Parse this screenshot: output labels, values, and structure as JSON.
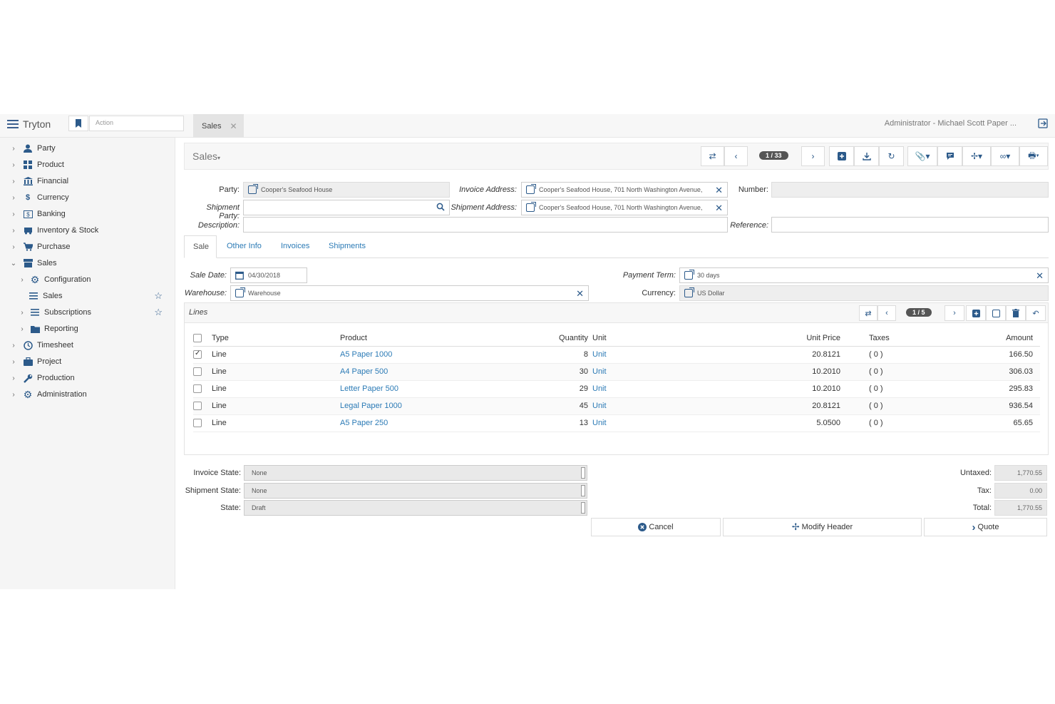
{
  "topbar": {
    "brand": "Tryton",
    "action_placeholder": "Action",
    "tab_label": "Sales",
    "user_info": "Administrator - Michael Scott Paper ..."
  },
  "sidebar": {
    "items": [
      {
        "label": "Party",
        "icon": "person-icon"
      },
      {
        "label": "Product",
        "icon": "grid-icon"
      },
      {
        "label": "Financial",
        "icon": "bank-icon"
      },
      {
        "label": "Currency",
        "icon": "dollar-icon"
      },
      {
        "label": "Banking",
        "icon": "banking-icon"
      },
      {
        "label": "Inventory & Stock",
        "icon": "truck-icon"
      },
      {
        "label": "Purchase",
        "icon": "cart-icon"
      },
      {
        "label": "Sales",
        "icon": "store-icon"
      },
      {
        "label": "Configuration",
        "icon": "gear-icon"
      },
      {
        "label": "Sales",
        "icon": "list-icon"
      },
      {
        "label": "Subscriptions",
        "icon": "list-icon"
      },
      {
        "label": "Reporting",
        "icon": "folder-icon"
      },
      {
        "label": "Timesheet",
        "icon": "clock-icon"
      },
      {
        "label": "Project",
        "icon": "briefcase-icon"
      },
      {
        "label": "Production",
        "icon": "wrench-icon"
      },
      {
        "label": "Administration",
        "icon": "gear-icon"
      }
    ]
  },
  "header": {
    "title": "Sales",
    "record_counter": "1 / 33"
  },
  "form": {
    "party_label": "Party:",
    "party_value": "Cooper's Seafood House",
    "invoice_address_label": "Invoice Address:",
    "invoice_address_value": "Cooper's Seafood House, 701 North Washington Avenue,",
    "number_label": "Number:",
    "shipment_party_label": "Shipment Party:",
    "shipment_address_label": "Shipment Address:",
    "shipment_address_value": "Cooper's Seafood House, 701 North Washington Avenue,",
    "description_label": "Description:",
    "reference_label": "Reference:"
  },
  "tabs": [
    "Sale",
    "Other Info",
    "Invoices",
    "Shipments"
  ],
  "sale": {
    "sale_date_label": "Sale Date:",
    "sale_date_value": "04/30/2018",
    "payment_term_label": "Payment Term:",
    "payment_term_value": "30 days",
    "warehouse_label": "Warehouse:",
    "warehouse_value": "Warehouse",
    "currency_label": "Currency:",
    "currency_value": "US Dollar"
  },
  "lines": {
    "title": "Lines",
    "counter": "1 / 5",
    "columns": [
      "Type",
      "Product",
      "Quantity",
      "Unit",
      "Unit Price",
      "Taxes",
      "Amount"
    ],
    "rows": [
      {
        "checked": true,
        "type": "Line",
        "product": "A5 Paper 1000",
        "quantity": "8",
        "unit": "Unit",
        "unit_price": "20.8121",
        "taxes": "( 0 )",
        "amount": "166.50"
      },
      {
        "checked": false,
        "type": "Line",
        "product": "A4 Paper 500",
        "quantity": "30",
        "unit": "Unit",
        "unit_price": "10.2010",
        "taxes": "( 0 )",
        "amount": "306.03"
      },
      {
        "checked": false,
        "type": "Line",
        "product": "Letter Paper 500",
        "quantity": "29",
        "unit": "Unit",
        "unit_price": "10.2010",
        "taxes": "( 0 )",
        "amount": "295.83"
      },
      {
        "checked": false,
        "type": "Line",
        "product": "Legal Paper 1000",
        "quantity": "45",
        "unit": "Unit",
        "unit_price": "20.8121",
        "taxes": "( 0 )",
        "amount": "936.54"
      },
      {
        "checked": false,
        "type": "Line",
        "product": "A5 Paper 250",
        "quantity": "13",
        "unit": "Unit",
        "unit_price": "5.0500",
        "taxes": "( 0 )",
        "amount": "65.65"
      }
    ]
  },
  "footer": {
    "invoice_state_label": "Invoice State:",
    "invoice_state_value": "None",
    "shipment_state_label": "Shipment State:",
    "shipment_state_value": "None",
    "state_label": "State:",
    "state_value": "Draft",
    "untaxed_label": "Untaxed:",
    "untaxed_value": "1,770.55",
    "tax_label": "Tax:",
    "tax_value": "0.00",
    "total_label": "Total:",
    "total_value": "1,770.55"
  },
  "buttons": {
    "cancel": "Cancel",
    "modify_header": "Modify Header",
    "quote": "Quote"
  },
  "colors": {
    "accent": "#2c5a8a",
    "link": "#2c7bb6"
  }
}
